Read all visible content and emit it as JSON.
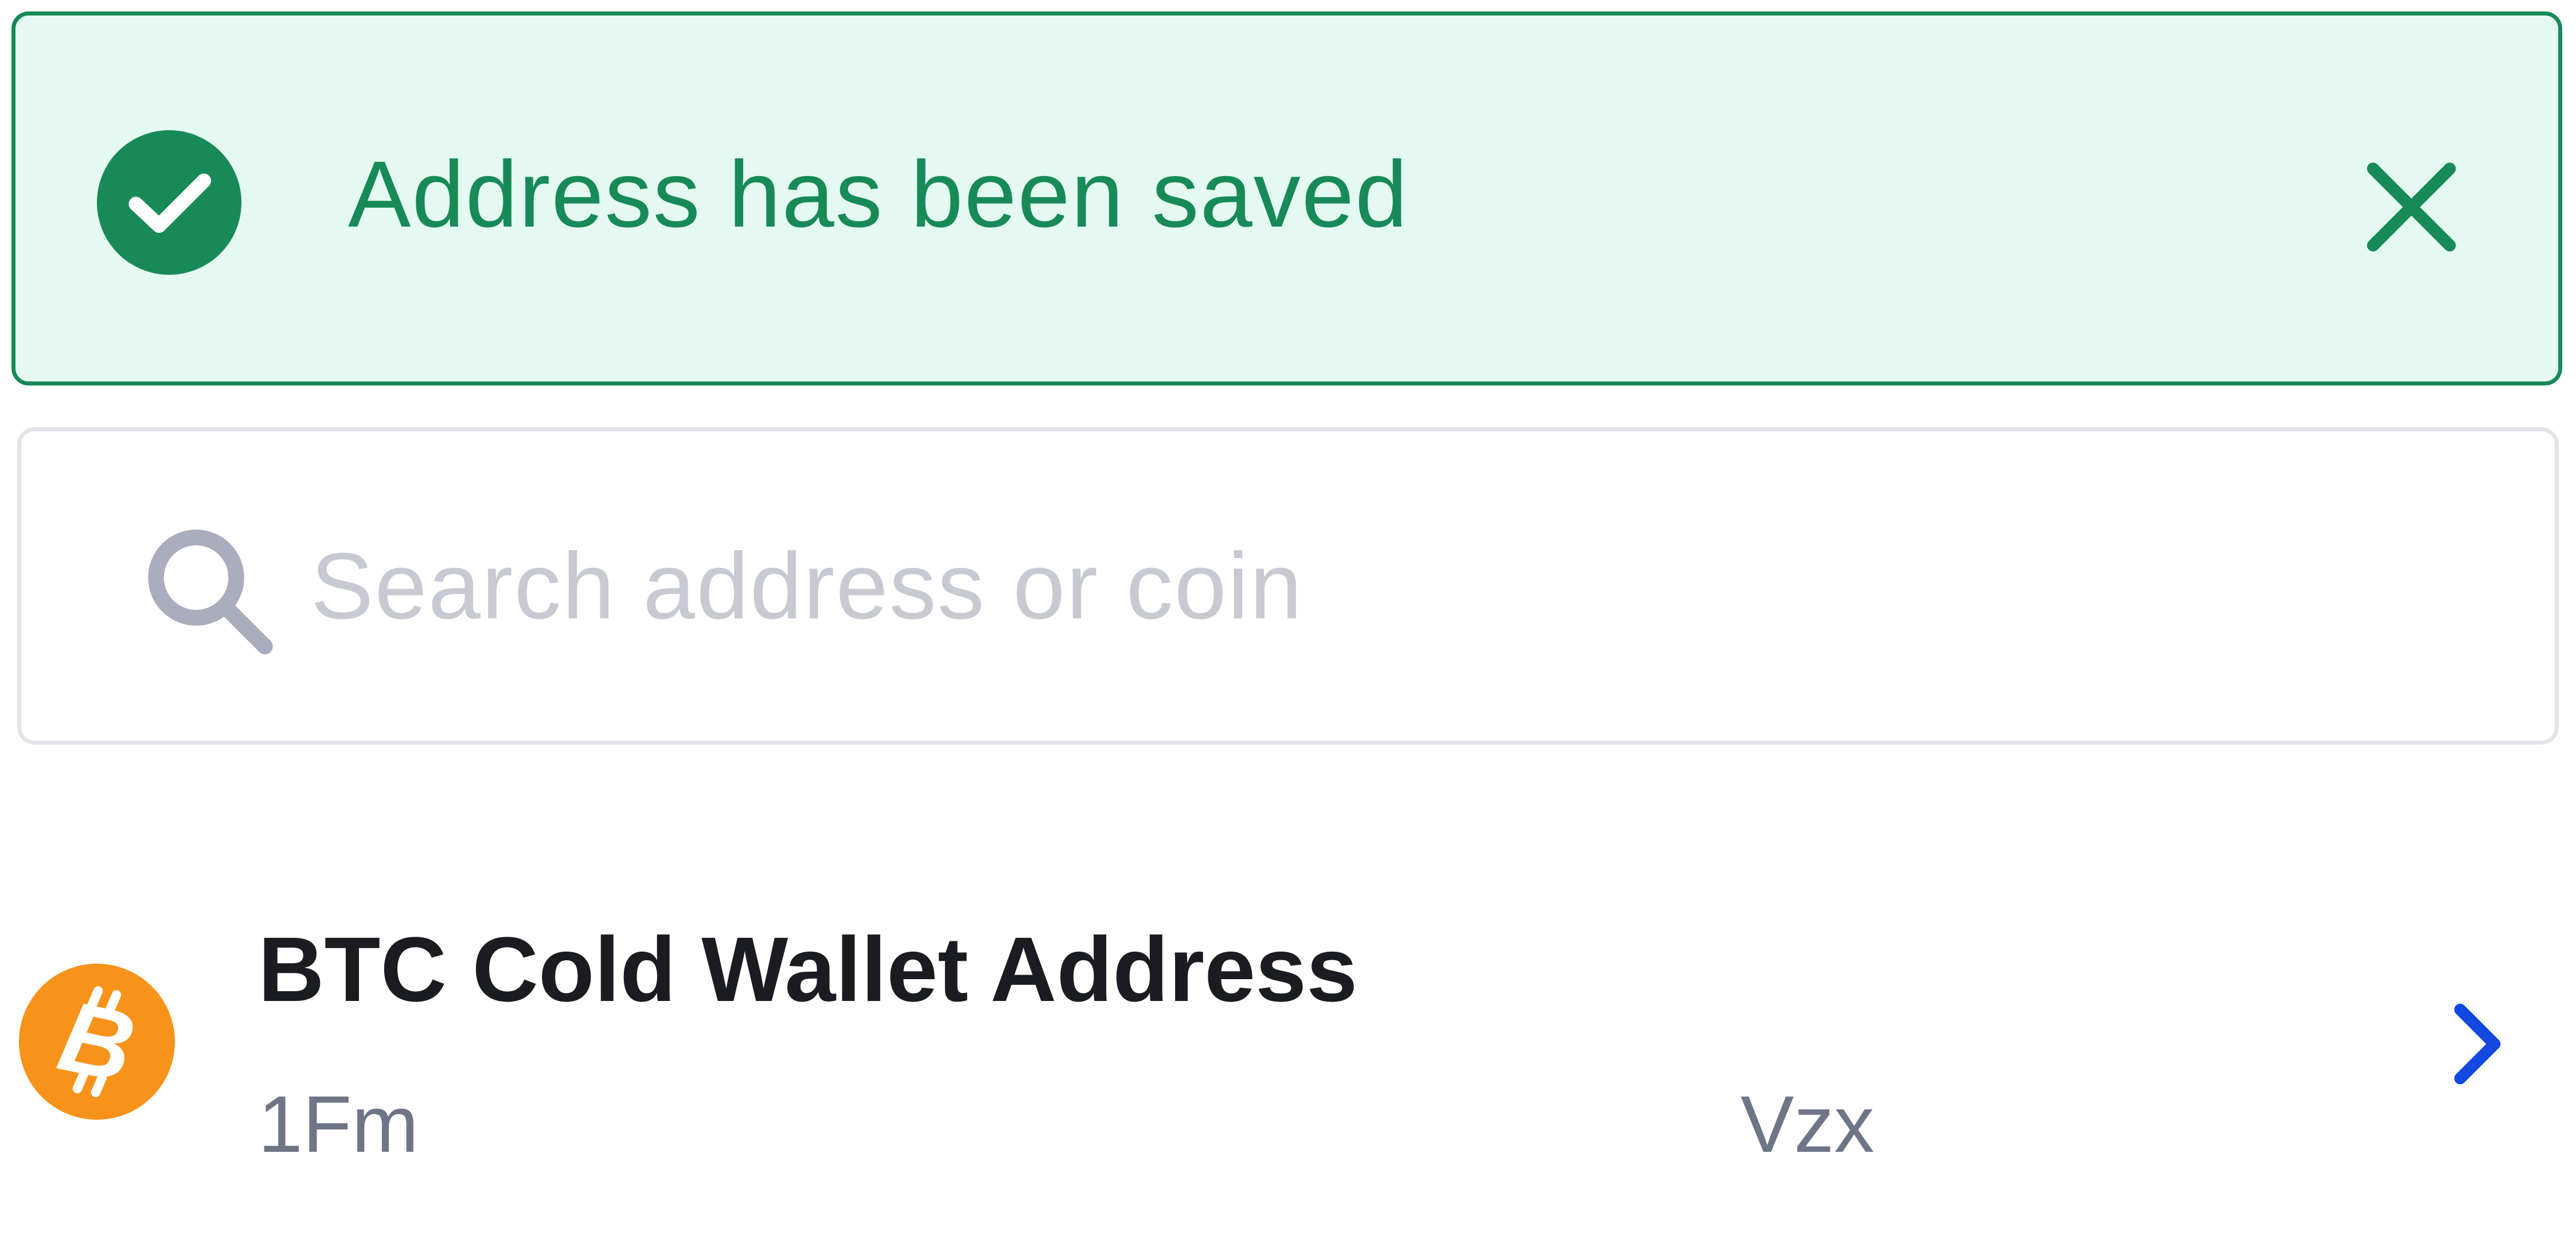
{
  "toast": {
    "message": "Address has been saved",
    "status": "success",
    "accent_color": "#178a57",
    "background_color": "#e3f9f1",
    "icon": "check-circle-icon",
    "close_icon": "close-icon"
  },
  "search": {
    "placeholder": "Search address or coin",
    "value": "",
    "icon": "search-icon"
  },
  "addresses": [
    {
      "label": "BTC Cold Wallet Address",
      "address_start": "1Fm",
      "address_end": "Vzx",
      "coin_icon": "bitcoin-icon",
      "coin_color": "#f7931a",
      "action_icon": "chevron-right-icon",
      "action_color": "#1548e0"
    }
  ]
}
